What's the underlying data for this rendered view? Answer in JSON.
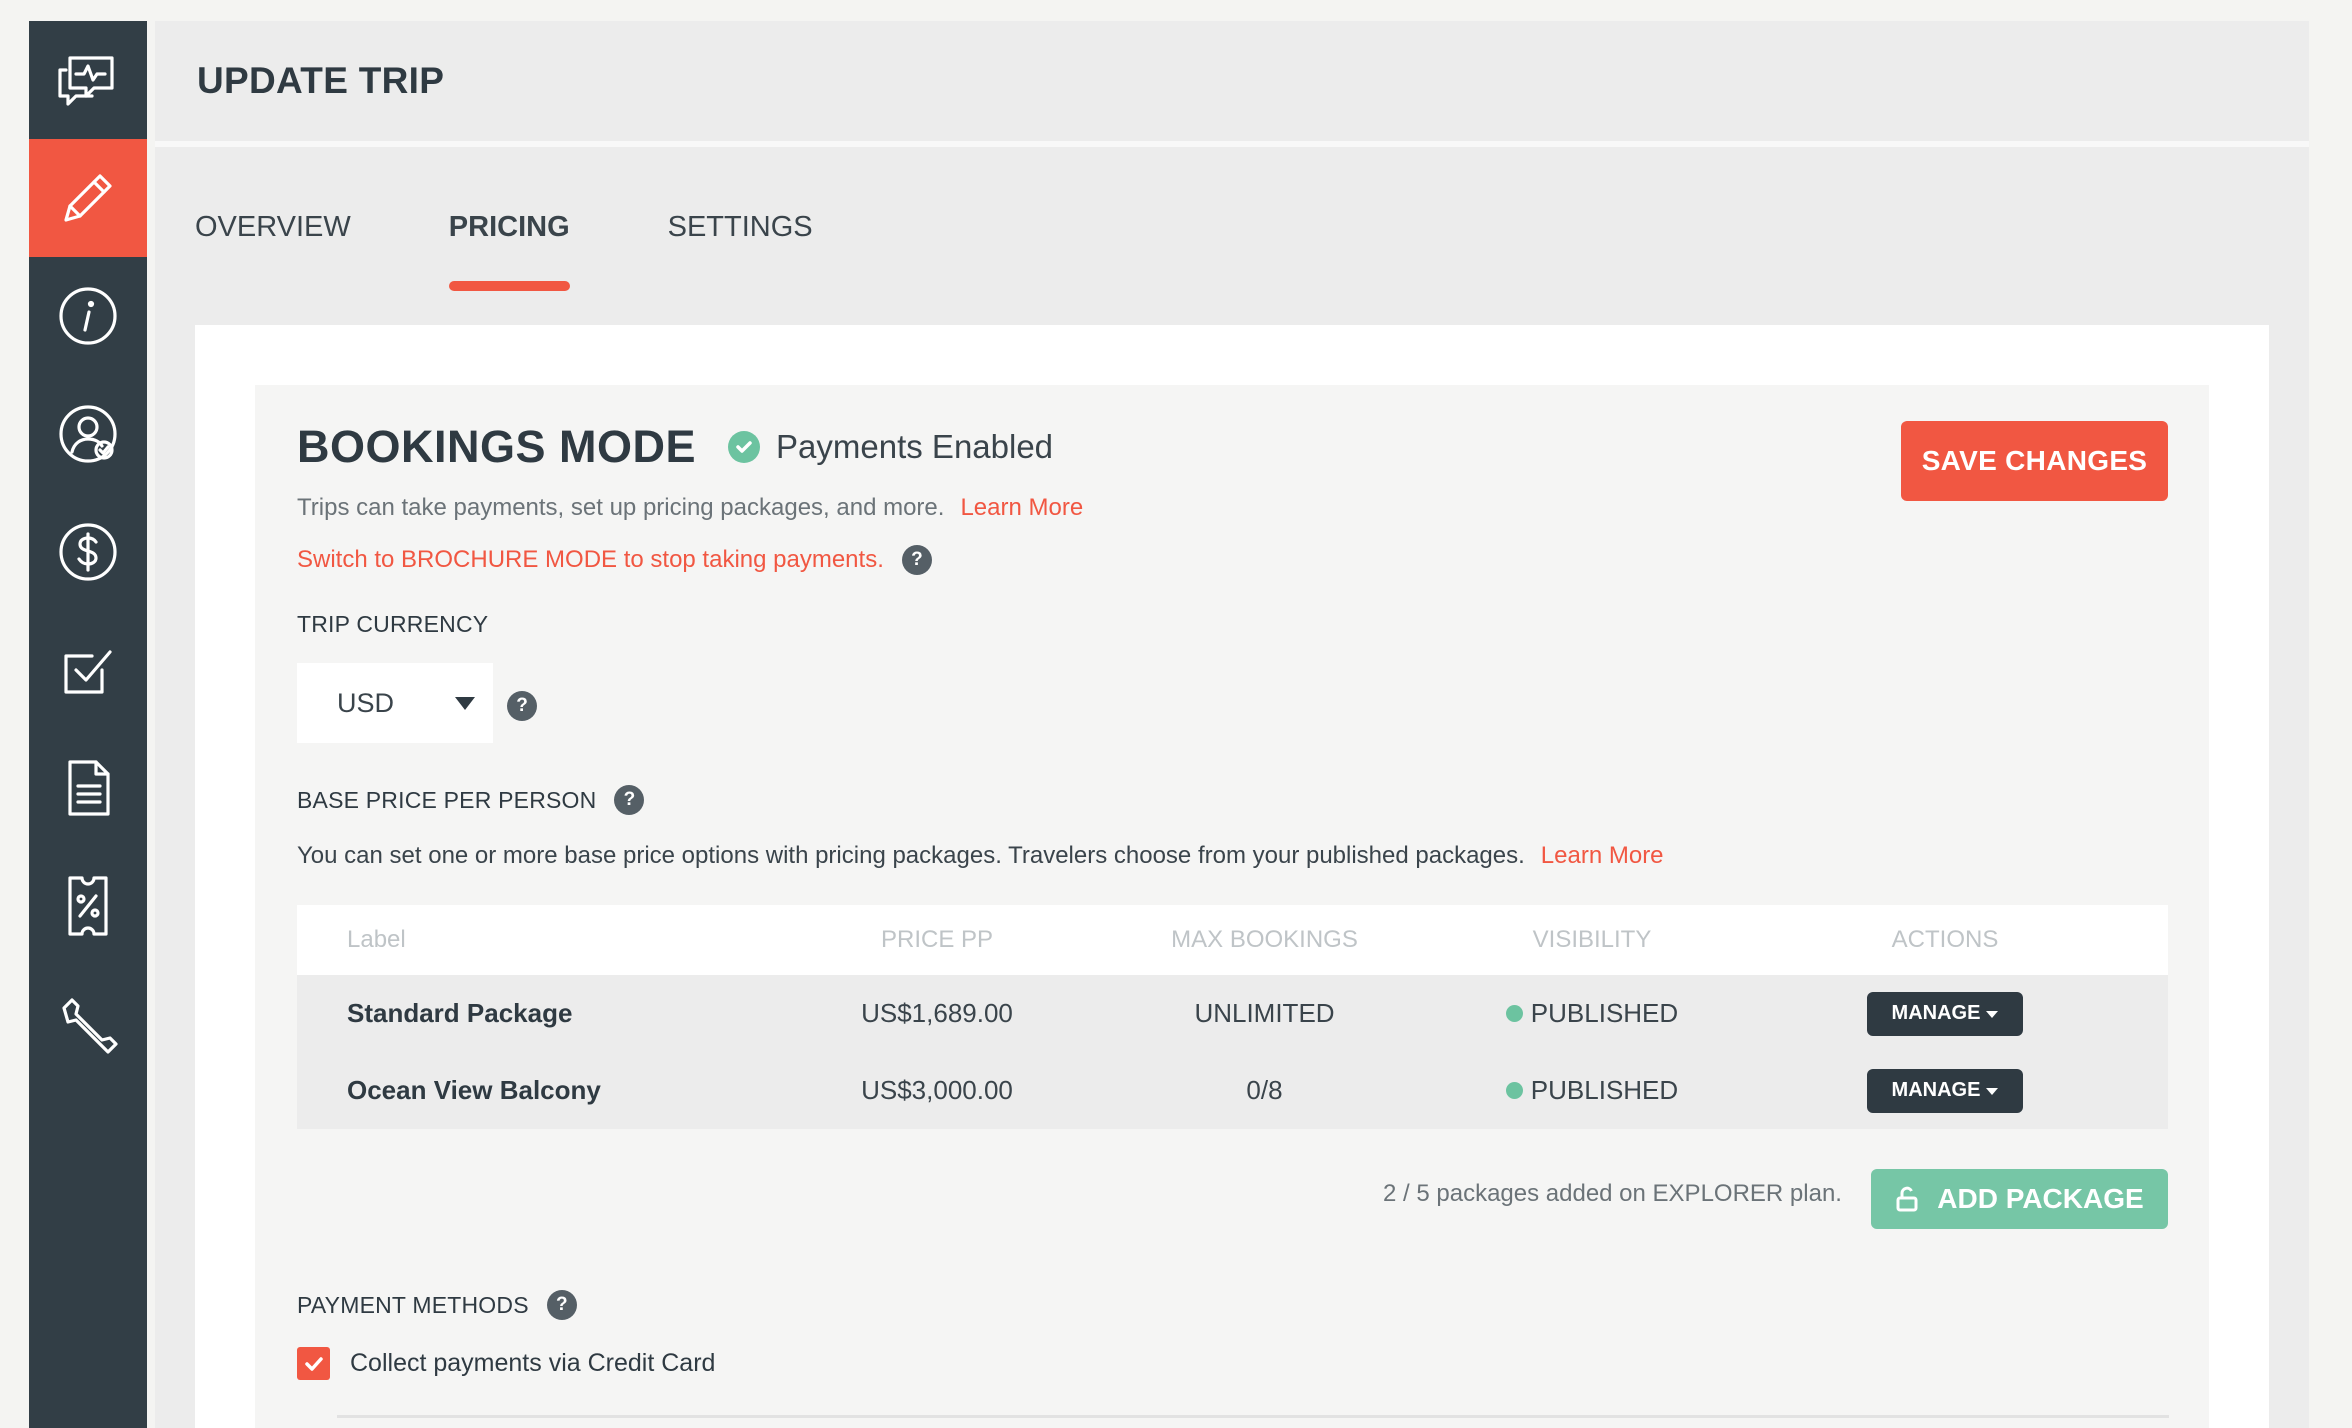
{
  "sidebar": {
    "items": [
      {
        "name": "chat-activity-icon",
        "active": false
      },
      {
        "name": "pencil-icon",
        "active": true
      },
      {
        "name": "info-icon",
        "active": false
      },
      {
        "name": "user-check-icon",
        "active": false
      },
      {
        "name": "dollar-icon",
        "active": false
      },
      {
        "name": "checkbox-icon",
        "active": false
      },
      {
        "name": "document-icon",
        "active": false
      },
      {
        "name": "coupon-icon",
        "active": false
      },
      {
        "name": "wrench-icon",
        "active": false
      }
    ]
  },
  "header": {
    "title": "UPDATE TRIP"
  },
  "tabs": [
    {
      "label": "OVERVIEW",
      "active": false
    },
    {
      "label": "PRICING",
      "active": true
    },
    {
      "label": "SETTINGS",
      "active": false
    }
  ],
  "bookings": {
    "title": "BOOKINGS MODE",
    "status": "Payments Enabled",
    "save_label": "SAVE CHANGES",
    "description": "Trips can take payments, set up pricing packages, and more.",
    "learn_more": "Learn More",
    "brochure_link": "Switch to BROCHURE MODE to stop taking payments.",
    "help": "?"
  },
  "currency": {
    "label": "TRIP CURRENCY",
    "value": "USD"
  },
  "base_price": {
    "label": "BASE PRICE PER PERSON",
    "description": "You can set one or more base price options with pricing packages. Travelers choose from your published packages.",
    "learn_more": "Learn More"
  },
  "packages": {
    "columns": [
      "Label",
      "PRICE PP",
      "MAX BOOKINGS",
      "VISIBILITY",
      "ACTIONS"
    ],
    "rows": [
      {
        "label": "Standard Package",
        "price": "US$1,689.00",
        "max": "UNLIMITED",
        "visibility": "PUBLISHED",
        "action": "MANAGE"
      },
      {
        "label": "Ocean View Balcony",
        "price": "US$3,000.00",
        "max": "0/8",
        "visibility": "PUBLISHED",
        "action": "MANAGE"
      }
    ],
    "plan_note": "2 / 5 packages added on EXPLORER plan.",
    "add_label": "ADD PACKAGE"
  },
  "payment": {
    "label": "PAYMENT METHODS",
    "credit_card_label": "Collect payments via Credit Card",
    "credit_card_checked": true
  },
  "colors": {
    "accent": "#f15742",
    "sidebar": "#323e46",
    "success": "#6cc3a0"
  }
}
